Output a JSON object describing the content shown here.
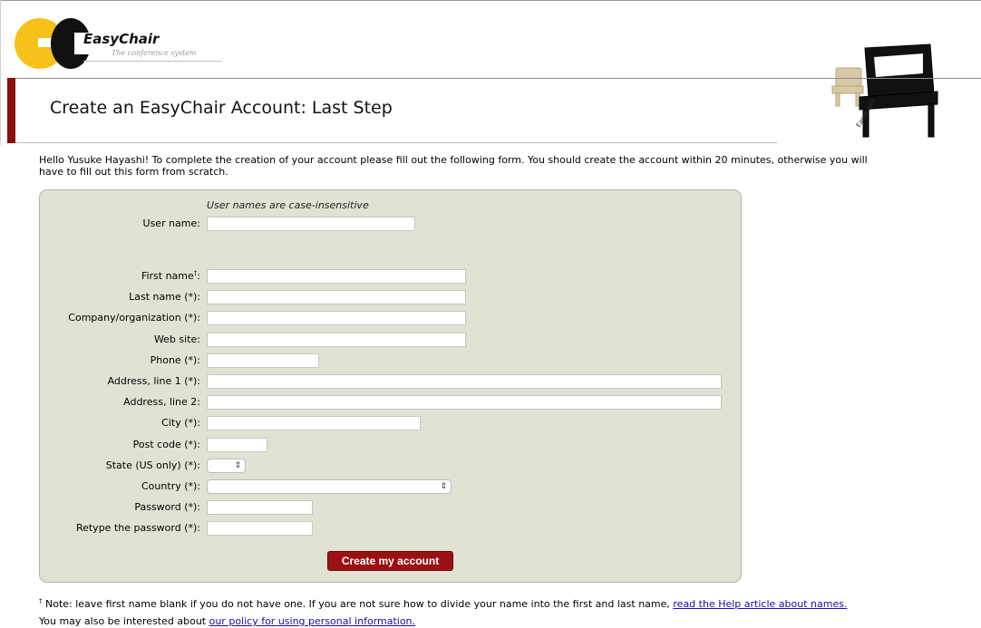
{
  "logo": {
    "name": "EasyChair",
    "tagline": "The conference system"
  },
  "chair_logo_text": "EasyChair",
  "title": "Create an EasyChair Account: Last Step",
  "intro": "Hello Yusuke Hayashi! To complete the creation of your account please fill out the following form. You should create the account within 20 minutes, otherwise you will have to fill out this form from scratch.",
  "form": {
    "username_hint": "User names are case-insensitive",
    "username_label": "User name:",
    "first_name_label": "First name",
    "first_name_mark": "†",
    "first_name_colon": ":",
    "last_name_label": "Last name (*):",
    "company_label": "Company/organization (*):",
    "website_label": "Web site:",
    "phone_label": "Phone (*):",
    "address1_label": "Address, line 1 (*):",
    "address2_label": "Address, line 2:",
    "city_label": "City (*):",
    "postcode_label": "Post code (*):",
    "state_label": "State (US only) (*):",
    "country_label": "Country (*):",
    "password_label": "Password (*):",
    "retype_label": "Retype the password (*):",
    "submit_label": "Create my account",
    "values": {
      "username": "",
      "first_name": "",
      "last_name": "",
      "company": "",
      "website": "",
      "phone": "",
      "address1": "",
      "address2": "",
      "city": "",
      "postcode": "",
      "state": "",
      "country": "",
      "password": "",
      "retype": ""
    }
  },
  "footnote": {
    "mark": "†",
    "text": " Note: leave first name blank if you do not have one. If you are not sure how to divide your name into the first and last name, ",
    "help_link": "read the Help article about names.",
    "policy_text": "You may also be interested about ",
    "policy_link": "our policy for using personal information."
  },
  "colors": {
    "accent": "#9b1113",
    "panel": "#e2e2d4",
    "logo_yellow": "#f6c21a"
  },
  "icons": {
    "select_arrow": "updown-chevron-icon"
  }
}
